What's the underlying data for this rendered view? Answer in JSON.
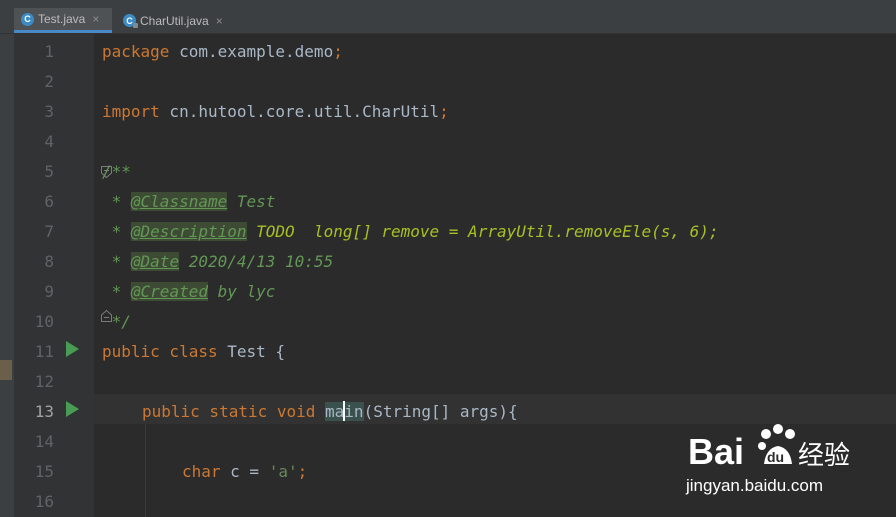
{
  "tabs": [
    {
      "label": "Test.java",
      "icon": "java-class-icon",
      "close": "×",
      "active": true
    },
    {
      "label": "CharUtil.java",
      "icon": "java-class-icon",
      "close": "×",
      "active": false
    }
  ],
  "gutter": {
    "line_numbers": [
      "1",
      "2",
      "3",
      "4",
      "5",
      "6",
      "7",
      "8",
      "9",
      "10",
      "11",
      "12",
      "13",
      "14",
      "15",
      "16"
    ],
    "current_line": "13",
    "run_icon": "run-triangle-icon",
    "fold_icon": "fold-marker-icon"
  },
  "code": {
    "l1": {
      "kw": "package",
      "rest": " com.example.demo",
      "semi": ";"
    },
    "l3": {
      "kw": "import",
      "rest": " cn.hutool.core.util.CharUtil",
      "semi": ";"
    },
    "l5": {
      "text": "/**"
    },
    "l6": {
      "star": " * ",
      "tag": "@Classname",
      "text": " Test"
    },
    "l7": {
      "star": " * ",
      "tag": "@Description",
      "todo": " TODO  long[] remove = ArrayUtil.removeEle(s, 6);"
    },
    "l8": {
      "star": " * ",
      "tag": "@Date",
      "text": " 2020/4/13 10:55"
    },
    "l9": {
      "star": " * ",
      "tag": "@Created",
      "text": " by lyc"
    },
    "l10": {
      "text": " */"
    },
    "l11": {
      "kw": "public class",
      "rest": " Test {"
    },
    "l13": {
      "kw": "public static void",
      "sp": " ",
      "name_a": "ma",
      "name_b": "in",
      "rest": "(String[] args){"
    },
    "l15": {
      "kw": "char",
      "rest": " c = ",
      "str": "'a'",
      "semi": ";"
    }
  },
  "watermark": {
    "brand": "Baidu 经验",
    "url": "jingyan.baidu.com"
  },
  "colors": {
    "background": "#2b2b2b",
    "keyword": "#cc7832",
    "plain": "#a9b7c6",
    "doc_comment": "#629755",
    "todo": "#a8c023",
    "string": "#6a8759",
    "run_icon": "#499c54"
  }
}
